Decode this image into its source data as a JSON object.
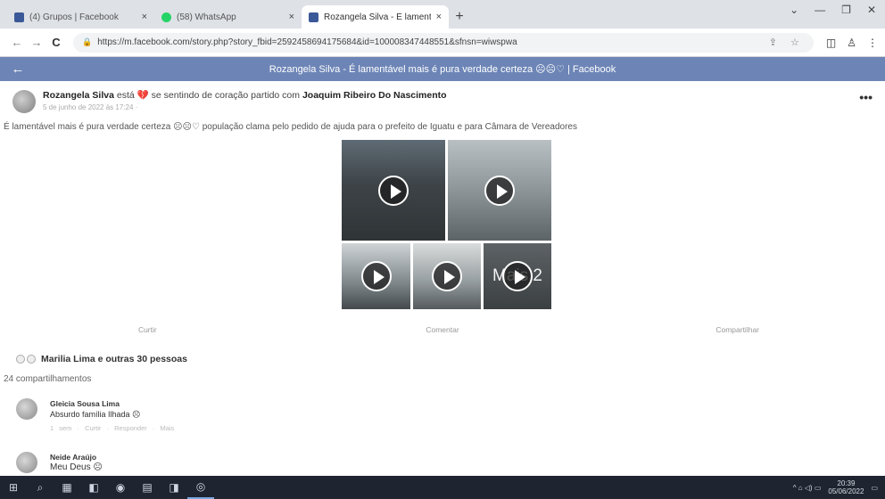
{
  "browser": {
    "tabs": [
      {
        "title": "(4) Grupos | Facebook",
        "close": "×",
        "favicon_color": "#3b5998",
        "active": false
      },
      {
        "title": "(58) WhatsApp",
        "close": "×",
        "favicon_color": "#25d366",
        "active": false
      },
      {
        "title": "Rozangela Silva - É lamentável -",
        "close": "×",
        "favicon_color": "#3b5998",
        "active": true
      }
    ],
    "new_tab": "+",
    "window_controls": {
      "minimize": "—",
      "restore": "❐",
      "close": "✕",
      "menu": "⌄"
    },
    "nav": {
      "back": "←",
      "forward": "→",
      "reload": "C"
    },
    "url": "https://m.facebook.com/story.php?story_fbid=2592458694175684&id=100008347448551&sfnsn=wiwspwa",
    "lock_icon": "lock-icon"
  },
  "fb_header": {
    "back": "←",
    "title": "Rozangela Silva - É lamentável mais é pura verdade certeza ☹☹♡ | Facebook"
  },
  "post": {
    "author": "Rozangela Silva",
    "feeling_prefix": "está",
    "feeling": "se sentindo de coração partido com",
    "tagged": "Joaquim Ribeiro Do Nascimento",
    "meta": "5 de junho de 2022 às 17:24 · ",
    "more": "•••",
    "text": "É lamentável mais é pura verdade certeza ☹☹♡ população clama pelo pedido de ajuda para o prefeito de Iguatu e para Câmara de Vereadores",
    "media_more_label": "Mais 2",
    "actions": {
      "like": "Curtir",
      "comment": "Comentar",
      "share": "Compartilhar"
    },
    "reactions_text": "Marilia Lima e outras 30 pessoas",
    "shares_text": "24 compartilhamentos"
  },
  "comments": [
    {
      "name": "Gleicia Sousa Lima",
      "text": "Absurdo família Ilhada ☹",
      "links": "1 sem · Curtir · Responder · Mais"
    },
    {
      "name": "Neide Araújo",
      "text": "Meu Deus ☹",
      "links": ""
    }
  ],
  "taskbar": {
    "items": [
      "⊞",
      "⌕",
      "▦",
      "◧",
      "◉",
      "▤",
      "◨",
      "◎"
    ],
    "tray_icons": "^  ⌂  ◁)  ▭",
    "time": "20:39",
    "date": "05/06/2022"
  }
}
